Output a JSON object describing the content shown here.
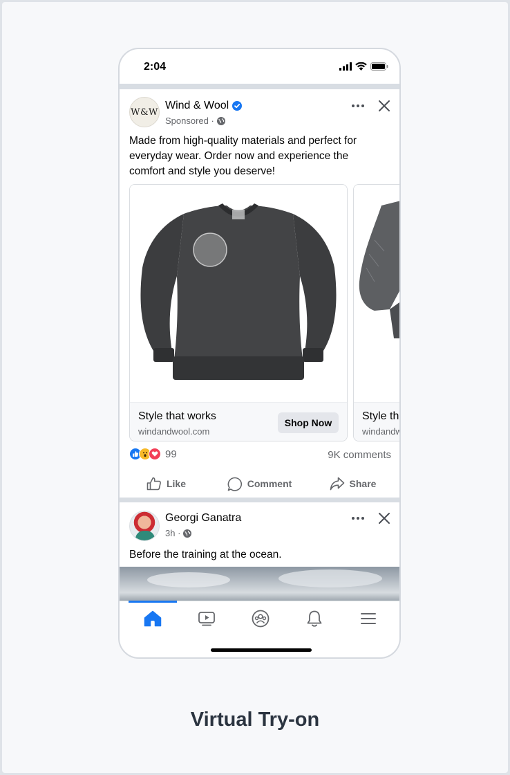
{
  "status_bar": {
    "time": "2:04"
  },
  "ad_post": {
    "avatar_text": "W&W",
    "author": "Wind & Wool",
    "verified": true,
    "sponsored_label": "Sponsored ·",
    "text_lines": [
      "Made from high-quality materials and perfect for",
      "everyday wear. Order now and experience the",
      "comfort and style you deserve!"
    ],
    "cards": [
      {
        "headline": "Style that works",
        "domain": "windandwool.com",
        "cta": "Shop Now",
        "image": "dark-gray-crewneck-sweatshirt"
      },
      {
        "headline": "Style that works",
        "domain": "windandwool.com",
        "image": "gray-denim-jacket"
      }
    ],
    "reactions": {
      "icons": [
        "like-icon",
        "wow-icon",
        "love-icon"
      ],
      "count": "99"
    },
    "comments": "9K comments",
    "actions": [
      {
        "label": "Like",
        "icon": "thumbs-up-icon"
      },
      {
        "label": "Comment",
        "icon": "comment-icon"
      },
      {
        "label": "Share",
        "icon": "share-icon"
      }
    ]
  },
  "second_post": {
    "author": "Georgi Ganatra",
    "time": "3h ·",
    "text": "Before the training at the ocean."
  },
  "bottom_nav": {
    "items": [
      "home-icon",
      "video-icon",
      "groups-icon",
      "notifications-icon",
      "menu-icon"
    ],
    "active": "home-icon"
  },
  "caption": "Virtual Try-on",
  "colors": {
    "accent": "#1877f2",
    "secondary_text": "#65676b",
    "like": "#1877f2",
    "wow": "#f7b928",
    "love": "#f33e58"
  }
}
